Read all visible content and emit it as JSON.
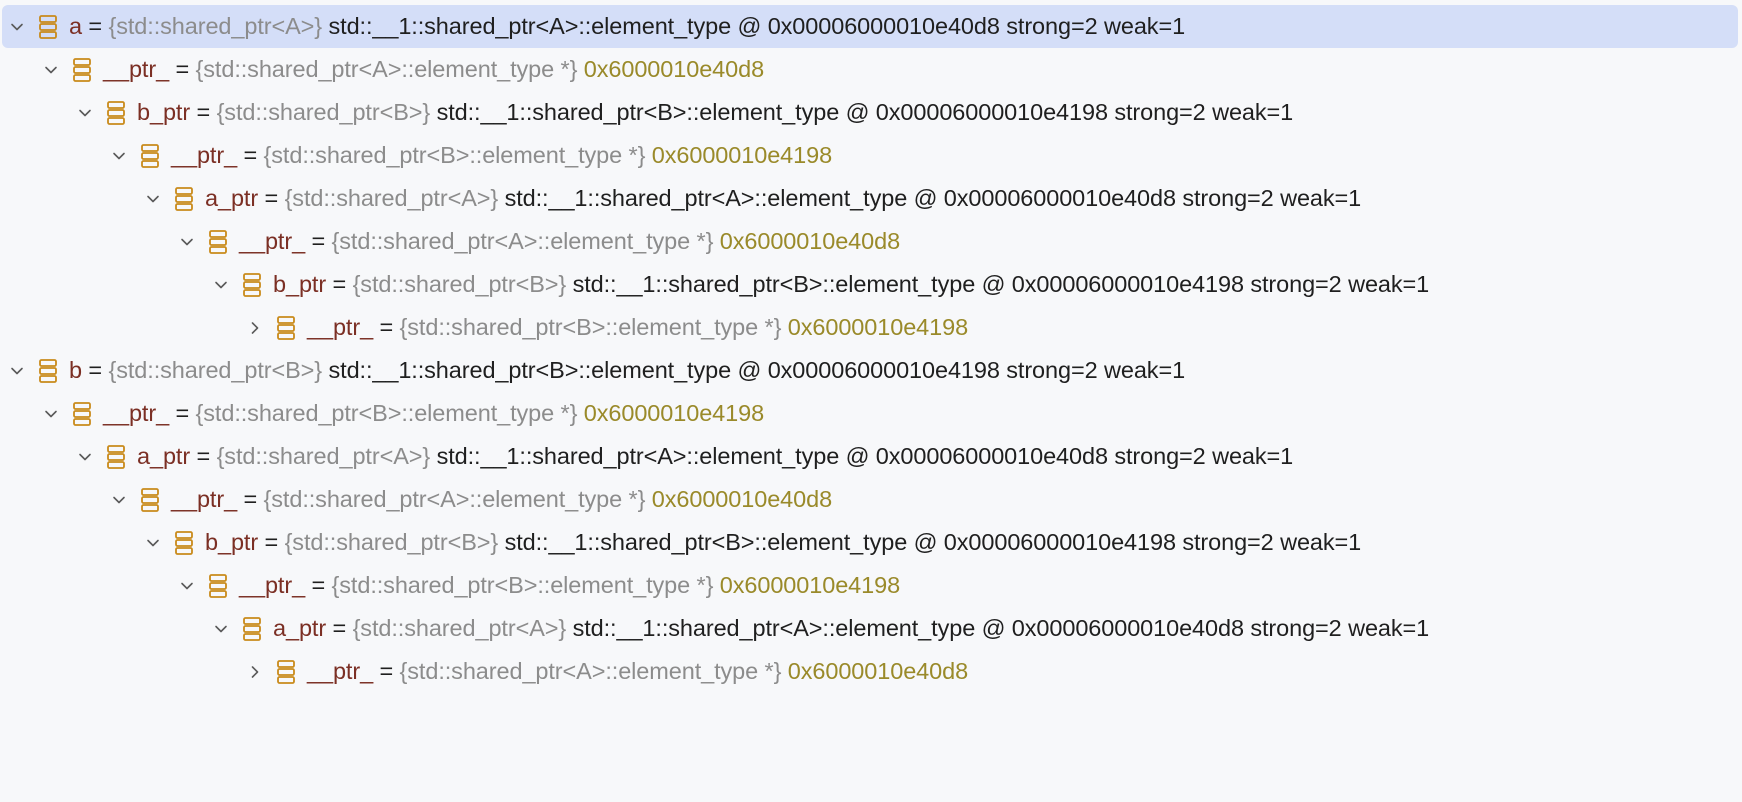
{
  "colors": {
    "selected_bg": "#d4def8",
    "name": "#7b2f24",
    "type": "#8c8c8c",
    "value": "#1f1f1f",
    "address": "#9a8a2a",
    "icon": "#c98a1a"
  },
  "rows": [
    {
      "depth": 0,
      "expanded": true,
      "selected": true,
      "name": "a",
      "type": "{std::shared_ptr<A>}",
      "value": "std::__1::shared_ptr<A>::element_type @ 0x00006000010e40d8 strong=2 weak=1",
      "address": ""
    },
    {
      "depth": 1,
      "expanded": true,
      "selected": false,
      "name": "__ptr_",
      "type": "{std::shared_ptr<A>::element_type *}",
      "value": "",
      "address": "0x6000010e40d8"
    },
    {
      "depth": 2,
      "expanded": true,
      "selected": false,
      "name": "b_ptr",
      "type": "{std::shared_ptr<B>}",
      "value": "std::__1::shared_ptr<B>::element_type @ 0x00006000010e4198 strong=2 weak=1",
      "address": ""
    },
    {
      "depth": 3,
      "expanded": true,
      "selected": false,
      "name": "__ptr_",
      "type": "{std::shared_ptr<B>::element_type *}",
      "value": "",
      "address": "0x6000010e4198"
    },
    {
      "depth": 4,
      "expanded": true,
      "selected": false,
      "name": "a_ptr",
      "type": "{std::shared_ptr<A>}",
      "value": "std::__1::shared_ptr<A>::element_type @ 0x00006000010e40d8 strong=2 weak=1",
      "address": ""
    },
    {
      "depth": 5,
      "expanded": true,
      "selected": false,
      "name": "__ptr_",
      "type": "{std::shared_ptr<A>::element_type *}",
      "value": "",
      "address": "0x6000010e40d8"
    },
    {
      "depth": 6,
      "expanded": true,
      "selected": false,
      "name": "b_ptr",
      "type": "{std::shared_ptr<B>}",
      "value": "std::__1::shared_ptr<B>::element_type @ 0x00006000010e4198 strong=2 weak=1",
      "address": ""
    },
    {
      "depth": 7,
      "expanded": false,
      "selected": false,
      "name": "__ptr_",
      "type": "{std::shared_ptr<B>::element_type *}",
      "value": "",
      "address": "0x6000010e4198"
    },
    {
      "depth": 0,
      "expanded": true,
      "selected": false,
      "name": "b",
      "type": "{std::shared_ptr<B>}",
      "value": "std::__1::shared_ptr<B>::element_type @ 0x00006000010e4198 strong=2 weak=1",
      "address": ""
    },
    {
      "depth": 1,
      "expanded": true,
      "selected": false,
      "name": "__ptr_",
      "type": "{std::shared_ptr<B>::element_type *}",
      "value": "",
      "address": "0x6000010e4198"
    },
    {
      "depth": 2,
      "expanded": true,
      "selected": false,
      "name": "a_ptr",
      "type": "{std::shared_ptr<A>}",
      "value": "std::__1::shared_ptr<A>::element_type @ 0x00006000010e40d8 strong=2 weak=1",
      "address": ""
    },
    {
      "depth": 3,
      "expanded": true,
      "selected": false,
      "name": "__ptr_",
      "type": "{std::shared_ptr<A>::element_type *}",
      "value": "",
      "address": "0x6000010e40d8"
    },
    {
      "depth": 4,
      "expanded": true,
      "selected": false,
      "name": "b_ptr",
      "type": "{std::shared_ptr<B>}",
      "value": "std::__1::shared_ptr<B>::element_type @ 0x00006000010e4198 strong=2 weak=1",
      "address": ""
    },
    {
      "depth": 5,
      "expanded": true,
      "selected": false,
      "name": "__ptr_",
      "type": "{std::shared_ptr<B>::element_type *}",
      "value": "",
      "address": "0x6000010e4198"
    },
    {
      "depth": 6,
      "expanded": true,
      "selected": false,
      "name": "a_ptr",
      "type": "{std::shared_ptr<A>}",
      "value": "std::__1::shared_ptr<A>::element_type @ 0x00006000010e40d8 strong=2 weak=1",
      "address": ""
    },
    {
      "depth": 7,
      "expanded": false,
      "selected": false,
      "name": "__ptr_",
      "type": "{std::shared_ptr<A>::element_type *}",
      "value": "",
      "address": "0x6000010e40d8"
    }
  ]
}
